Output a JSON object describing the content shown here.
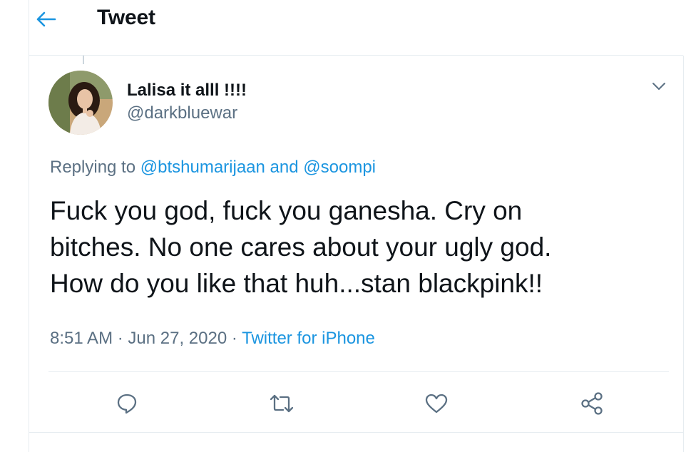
{
  "header": {
    "title": "Tweet",
    "back_icon": "arrow-left-icon"
  },
  "tweet": {
    "author": {
      "display_name": "Lalisa it alll !!!!",
      "handle": "@darkbluewar",
      "avatar_icon": "avatar-photo"
    },
    "replying": {
      "prefix": "Replying to",
      "user1": "@btshumarijaan",
      "joiner": "and",
      "user2": "@soompi"
    },
    "text_lines": [
      "Fuck you god, fuck you ganesha. Cry on",
      "bitches. No one cares about your ugly god.",
      "How do you like that huh...stan blackpink!!"
    ],
    "time": "8:51 AM",
    "separator": "·",
    "date": "Jun 27, 2020",
    "source": "Twitter for iPhone"
  },
  "actions": {
    "icons": [
      "reply-icon",
      "retweet-icon",
      "like-icon",
      "share-icon"
    ]
  },
  "colors": {
    "accent": "#1b95e0",
    "secondary_text": "#5b7083",
    "border": "#e6ecf0"
  }
}
